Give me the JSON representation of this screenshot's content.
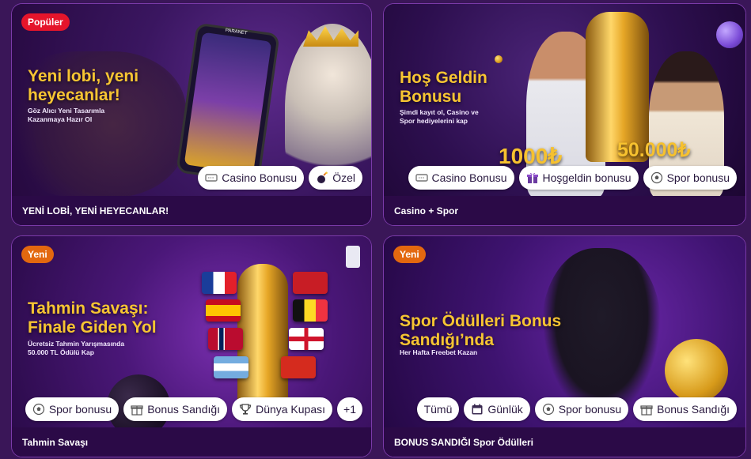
{
  "cards": [
    {
      "badge": "Popüler",
      "headline": "Yeni lobi, yeni heyecanlar!",
      "subline": "Göz Alıcı Yeni Tasarımla Kazanmaya Hazır Ol",
      "phone_brand": "PARANET",
      "tags": [
        "Casino Bonusu",
        "Özel"
      ],
      "title": "YENİ LOBİ, YENİ HEYECANLAR!"
    },
    {
      "badge": "",
      "headline": "Hoş Geldin Bonusu",
      "subline": "Şimdi kayıt ol, Casino ve Spor hediyelerini kap",
      "amount_left": "1000₺",
      "amount_right": "50.000₺",
      "tags": [
        "Casino Bonusu",
        "Hoşgeldin bonusu",
        "Spor bonusu"
      ],
      "title": "Casino + Spor"
    },
    {
      "badge": "Yeni",
      "headline": "Tahmin Savaşı: Finale Giden Yol",
      "subline": "Ücretsiz Tahmin Yarışmasında 50.000 TL Ödülü Kap",
      "tags": [
        "Spor bonusu",
        "Bonus Sandığı",
        "Dünya Kupası",
        "+1"
      ],
      "title": "Tahmin Savaşı"
    },
    {
      "badge": "Yeni",
      "headline": "Spor Ödülleri Bonus Sandığı’nda",
      "subline": "Her Hafta Freebet Kazan",
      "tags": [
        "Tümü",
        "Günlük",
        "Spor bonusu",
        "Bonus Sandığı"
      ],
      "title": "BONUS SANDIĞI Spor Ödülleri"
    }
  ],
  "icons": {
    "casino_bonus": "ticket-icon",
    "ozel": "bomb-icon",
    "hosgeldin": "gift-icon",
    "spor": "soccer-ball-icon",
    "bonus_sandigi": "gift-box-icon",
    "dunya_kupasi": "trophy-icon",
    "gunluk": "calendar-icon"
  },
  "colors": {
    "page_bg": "#3a1658",
    "card_footer": "#2b0a47",
    "badge_red": "#e5152b",
    "badge_orange": "#e3680f",
    "headline_gold": "#f7c532"
  }
}
